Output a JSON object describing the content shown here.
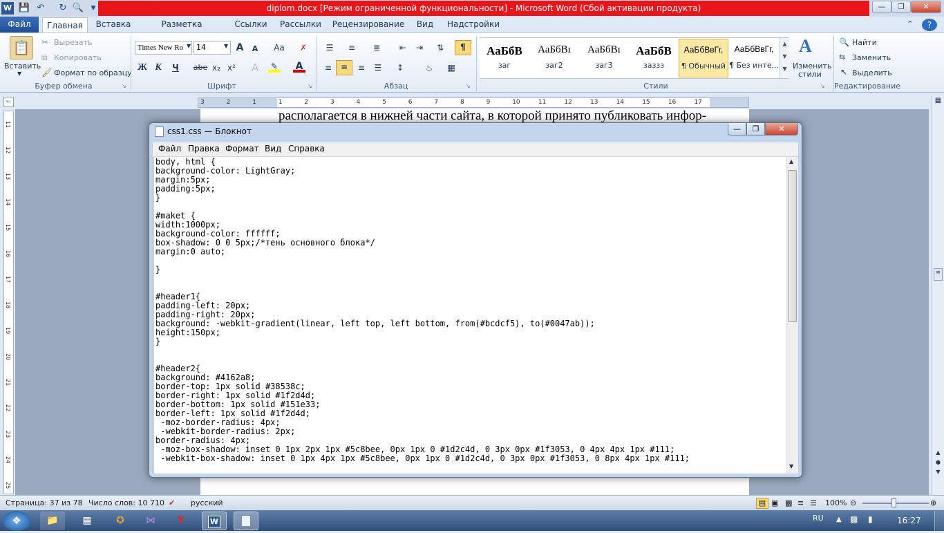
{
  "word": {
    "title": "diplom.docx [Режим ограниченной функциональности]  -  Microsoft Word (Сбой активации продукта)",
    "tabs": [
      "Файл",
      "Главная",
      "Вставка",
      "Разметка страницы",
      "Ссылки",
      "Рассылки",
      "Рецензирование",
      "Вид",
      "Надстройки"
    ],
    "clipboard": {
      "paste": "Вставить",
      "cut": "Вырезать",
      "copy": "Копировать",
      "format_painter": "Формат по образцу",
      "label": "Буфер обмена"
    },
    "font": {
      "name": "Times New Ro",
      "size": "14",
      "grow": "A",
      "shrink": "A",
      "change_case": "Aa",
      "bold": "Ж",
      "italic": "К",
      "underline": "Ч",
      "strike": "abe",
      "sub": "x₂",
      "sup": "x²",
      "label": "Шрифт"
    },
    "paragraph": {
      "label": "Абзац"
    },
    "styles": {
      "label": "Стили",
      "items": [
        {
          "sample": "АаБбВ",
          "name": "заг"
        },
        {
          "sample": "АаБбВı",
          "name": "заг2"
        },
        {
          "sample": "АаБбВı",
          "name": "заг3"
        },
        {
          "sample": "АаБбВ",
          "name": "заззз"
        },
        {
          "sample": "АаБбВвГг,",
          "name": "¶ Обычный"
        },
        {
          "sample": "АаБбВвГг,",
          "name": "¶ Без инте..."
        }
      ],
      "change": "Изменить",
      "change2": "стили"
    },
    "editing": {
      "find": "Найти",
      "replace": "Заменить",
      "select": "Выделить",
      "label": "Редактирование"
    },
    "ruler_marks": [
      "3",
      "2",
      "1",
      "1",
      "2",
      "3",
      "4",
      "5",
      "6",
      "7",
      "8",
      "9",
      "10",
      "11",
      "12",
      "13",
      "14",
      "15",
      "16",
      "17"
    ],
    "vruler_marks": [
      "11",
      "12",
      "13",
      "14",
      "15",
      "16",
      "17",
      "18",
      "19",
      "20",
      "21",
      "22",
      "23",
      "24",
      "25"
    ],
    "doc_line": "располагается в нижней части сайта, в которой принято публиковать инфор-",
    "status": {
      "page": "Страница: 37 из 78",
      "words": "Число слов: 10 710",
      "lang": "русский",
      "zoom": "100%"
    }
  },
  "notepad": {
    "title": "css1.css — Блокнот",
    "menu": [
      "Файл",
      "Правка",
      "Формат",
      "Вид",
      "Справка"
    ],
    "code": "body, html {\nbackground-color: LightGray;\nmargin:5px;\npadding:5px;\n}\n\n#maket {\nwidth:1000px;\nbackground-color: ffffff;\nbox-shadow: 0 0 5px;/*тень основного блока*/\nmargin:0 auto;\n\n}\n\n\n#header1{\npadding-left: 20px;\npadding-right: 20px;\nbackground: -webkit-gradient(linear, left top, left bottom, from(#bcdcf5), to(#0047ab));\nheight:150px;\n}\n\n\n#header2{\nbackground: #4162a8;\nborder-top: 1px solid #38538c;\nborder-right: 1px solid #1f2d4d;\nborder-bottom: 1px solid #151e33;\nborder-left: 1px solid #1f2d4d;\n -moz-border-radius: 4px;\n -webkit-border-radius: 2px;\nborder-radius: 4px;\n -moz-box-shadow: inset 0 1px 2px 1px #5c8bee, 0px 1px 0 #1d2c4d, 0 3px 0px #1f3053, 0 4px 4px 1px #111;\n -webkit-box-shadow: inset 0 1px 4px 1px #5c8bee, 0px 1px 0 #1d2c4d, 0 3px 0px #1f3053, 0 8px 4px 1px #111;"
  },
  "taskbar": {
    "lang": "RU",
    "time": "16:27"
  }
}
